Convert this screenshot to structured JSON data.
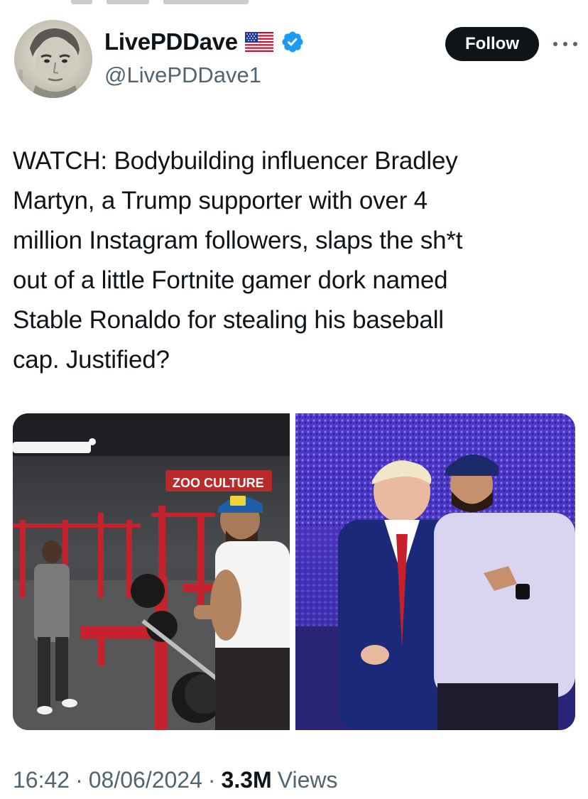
{
  "user": {
    "display_name": "LivePDDave",
    "handle": "@LivePDDave1",
    "flag_icon": "us-flag-icon",
    "verified_icon": "verified-badge-icon",
    "verified_color": "#1d9bf0"
  },
  "actions": {
    "follow_label": "Follow",
    "more_icon": "more-options-icon"
  },
  "tweet": {
    "text": "WATCH: Bodybuilding influencer Bradley\nMartyn, a Trump supporter with over 4\nmillion Instagram followers, slaps the sh*t\nout of a little Fortnite gamer dork named\nStable Ronaldo for stealing his baseball\ncap. Justified?"
  },
  "media": {
    "left_photo_sign": "ZOO CULTURE",
    "left_photo_subject": "gym-photo",
    "right_photo_subject": "arena-photo"
  },
  "meta": {
    "time": "16:42",
    "separator": "·",
    "date": "08/06/2024",
    "views_count": "3.3M",
    "views_label": "Views"
  },
  "colors": {
    "text": "#0f1419",
    "secondary": "#536471",
    "follow_bg": "#0f1419"
  }
}
